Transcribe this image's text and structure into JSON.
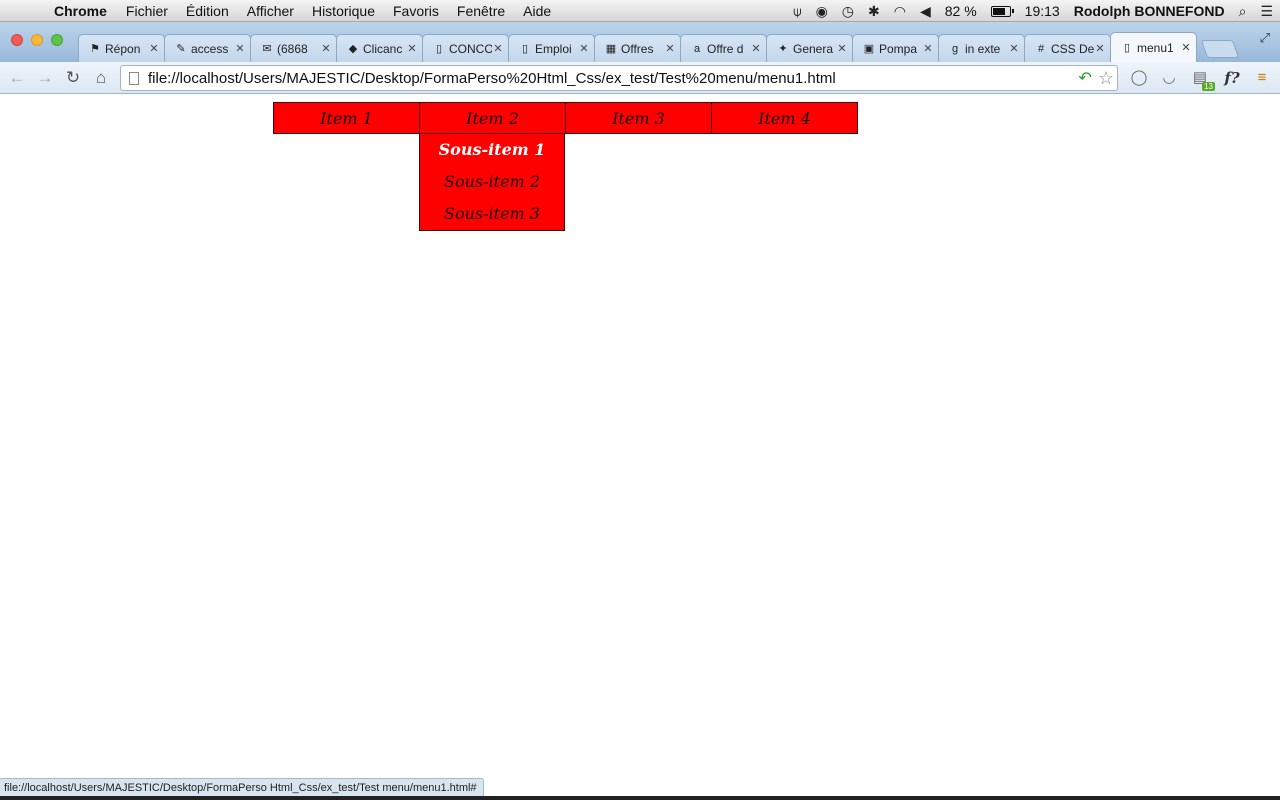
{
  "menubar": {
    "app_name": "Chrome",
    "items": [
      "Fichier",
      "Édition",
      "Afficher",
      "Historique",
      "Favoris",
      "Fenêtre",
      "Aide"
    ],
    "battery_text": "82 %",
    "time": "19:13",
    "user": "Rodolph BONNEFOND"
  },
  "tabs": [
    {
      "title": "Répon",
      "icon": "⚑"
    },
    {
      "title": "access",
      "icon": "✎"
    },
    {
      "title": "(6868",
      "icon": "✉"
    },
    {
      "title": "Clicanc",
      "icon": "◆"
    },
    {
      "title": "CONCO",
      "icon": "▯"
    },
    {
      "title": "Emploi",
      "icon": "▯"
    },
    {
      "title": "Offres",
      "icon": "▦"
    },
    {
      "title": "Offre d",
      "icon": "a"
    },
    {
      "title": "Genera",
      "icon": "✦"
    },
    {
      "title": "Pompa",
      "icon": "▣"
    },
    {
      "title": "in exte",
      "icon": "g"
    },
    {
      "title": "CSS De",
      "icon": "#"
    },
    {
      "title": "menu1",
      "icon": "▯",
      "active": true
    }
  ],
  "toolbar": {
    "url": "file://localhost/Users/MAJESTIC/Desktop/FormaPerso%20Html_Css/ex_test/Test%20menu/menu1.html",
    "ext_badge": "13",
    "ext_label": "f?"
  },
  "menu": {
    "items": [
      {
        "label": "Item 1"
      },
      {
        "label": "Item 2",
        "submenu": [
          "Sous-item 1",
          "Sous-item 2",
          "Sous-item 3"
        ],
        "hovered_sub": 0
      },
      {
        "label": "Item 3"
      },
      {
        "label": "Item 4"
      }
    ],
    "color": "#ff0000"
  },
  "status": {
    "text": "file://localhost/Users/MAJESTIC/Desktop/FormaPerso Html_Css/ex_test/Test menu/menu1.html#"
  }
}
